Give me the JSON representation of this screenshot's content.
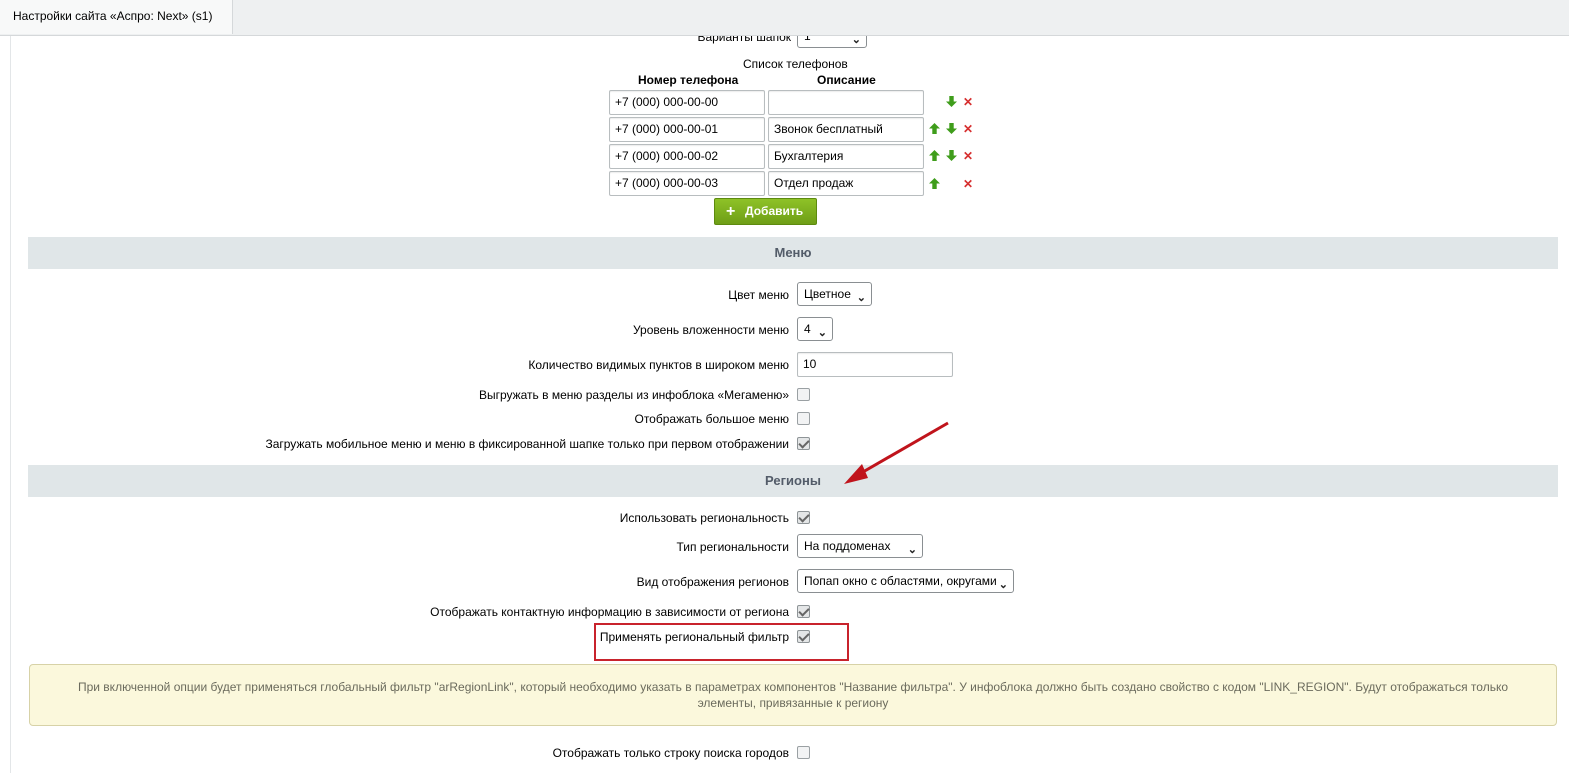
{
  "tab": {
    "title": "Настройки сайта «Аспро: Next» (s1)"
  },
  "header_row": {
    "partial_label": "Варианты шапок",
    "partial_value": "1"
  },
  "phones": {
    "title": "Список телефонов",
    "col_phone": "Номер телефона",
    "col_desc": "Описание",
    "rows": [
      {
        "phone": "+7 (000) 000-00-00",
        "desc": ""
      },
      {
        "phone": "+7 (000) 000-00-01",
        "desc": "Звонок бесплатный"
      },
      {
        "phone": "+7 (000) 000-00-02",
        "desc": "Бухгалтерия"
      },
      {
        "phone": "+7 (000) 000-00-03",
        "desc": "Отдел продаж"
      }
    ],
    "add_label": "Добавить"
  },
  "menu": {
    "section_title": "Меню",
    "color_label": "Цвет меню",
    "color_value": "Цветное",
    "level_label": "Уровень вложенности меню",
    "level_value": "4",
    "count_label": "Количество видимых пунктов в широком меню",
    "count_value": "10",
    "megamenu_label": "Выгружать в меню разделы из инфоблока «Мегаменю»",
    "bigmenu_label": "Отображать большое меню",
    "mobile_label": "Загружать мобильное меню и меню в фиксированной шапке только при первом отображении"
  },
  "regions": {
    "section_title": "Регионы",
    "use_label": "Использовать региональность",
    "type_label": "Тип региональности",
    "type_value": "На поддоменах",
    "view_label": "Вид отображения регионов",
    "view_value": "Попап окно с областями, округами",
    "contacts_label": "Отображать контактную информацию в зависимости от региона",
    "filter_label": "Применять региональный фильтр",
    "note": "При включенной опции будет применяться глобальный фильтр \"arRegionLink\", который необходимо указать в параметрах компонентов \"Название фильтра\". У инфоблока должно быть создано свойство с кодом \"LINK_REGION\". Будут отображаться только элементы, привязанные к региону",
    "search_only_label": "Отображать только строку поиска городов"
  },
  "colors": {
    "accent_green": "#7cb31e",
    "highlight_red": "#c8232c",
    "section_bg": "#e0e6e8"
  }
}
